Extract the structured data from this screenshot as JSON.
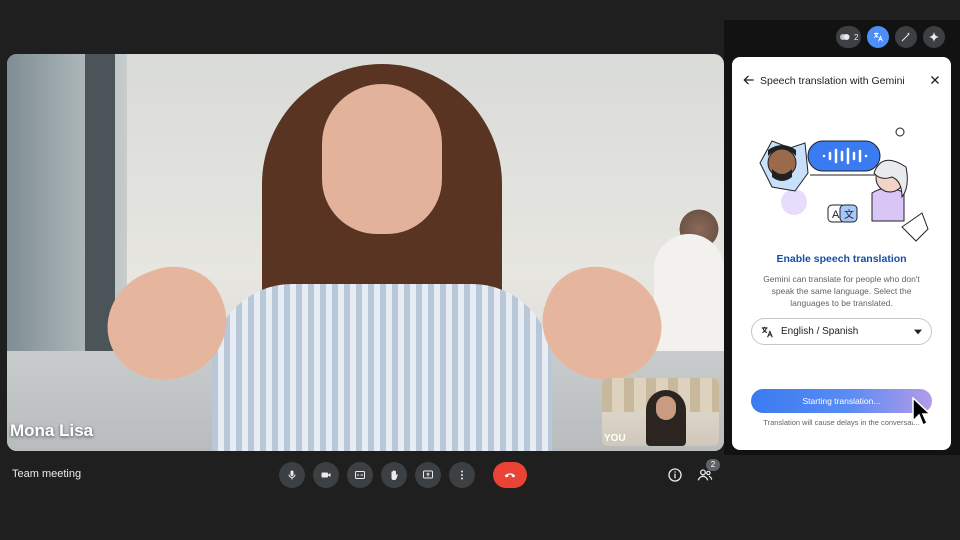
{
  "stage": {
    "speaker_name": "Mona Lisa",
    "self_label": "YOU"
  },
  "bottom_bar": {
    "meeting_title": "Team meeting",
    "controls": [
      "mic-icon",
      "camera-icon",
      "captions-icon",
      "raise-hand-icon",
      "present-icon",
      "more-options-icon",
      "end-call-icon"
    ],
    "people_count": "2",
    "end_call_color": "#ea4335"
  },
  "top_bar": {
    "participants_count": "2",
    "active_color": "#4d8ff7"
  },
  "panel": {
    "title": "Speech translation with Gemini",
    "enable_title": "Enable speech translation",
    "enable_desc": "Gemini can translate for people who don't speak the same language. Select the languages to be translated.",
    "language_value": "English / Spanish",
    "start_button": "Starting translation...",
    "start_note": "Translation will cause delays in the conversat..."
  },
  "colors": {
    "accent": "#1a73e8",
    "heading_blue": "#174ea6"
  }
}
